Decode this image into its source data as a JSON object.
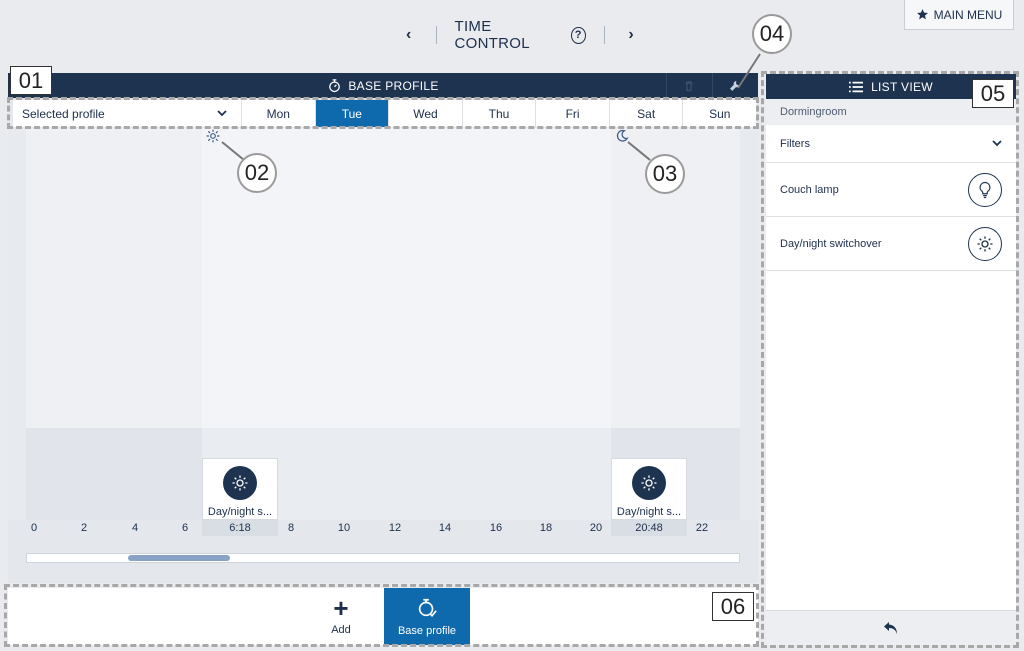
{
  "header": {
    "title": "TIME CONTROL",
    "prev_label": "‹",
    "next_label": "›",
    "help_label": "?",
    "main_menu_label": "MAIN MENU"
  },
  "profile_bar": {
    "title": "BASE PROFILE"
  },
  "day_row": {
    "selector_label": "Selected profile",
    "days": [
      "Mon",
      "Tue",
      "Wed",
      "Thu",
      "Fri",
      "Sat",
      "Sun"
    ],
    "active_day": "Tue"
  },
  "timeline": {
    "ticks": [
      "0",
      "2",
      "4",
      "6",
      "8",
      "10",
      "12",
      "14",
      "16",
      "18",
      "20",
      "22"
    ],
    "events": [
      {
        "label": "Day/night s...",
        "time": "6:18",
        "icon": "sun-icon"
      },
      {
        "label": "Day/night s...",
        "time": "20:48",
        "icon": "sun-icon"
      }
    ]
  },
  "bottom_bar": {
    "add_label": "Add",
    "add_glyph": "+",
    "base_profile_label": "Base profile"
  },
  "list_view": {
    "title": "LIST VIEW",
    "room": "Dormingroom",
    "filters_label": "Filters",
    "items": [
      {
        "label": "Couch lamp",
        "icon": "bulb-icon"
      },
      {
        "label": "Day/night switchover",
        "icon": "sun-icon"
      }
    ]
  },
  "annotations": {
    "a01": "01",
    "a02": "02",
    "a03": "03",
    "a04": "04",
    "a05": "05",
    "a06": "06"
  },
  "colors": {
    "header_bar": "#1d3350",
    "accent_blue": "#0f6aad",
    "panel_bg": "#e4e7ec",
    "annotation_dash": "#a8a8a8"
  }
}
